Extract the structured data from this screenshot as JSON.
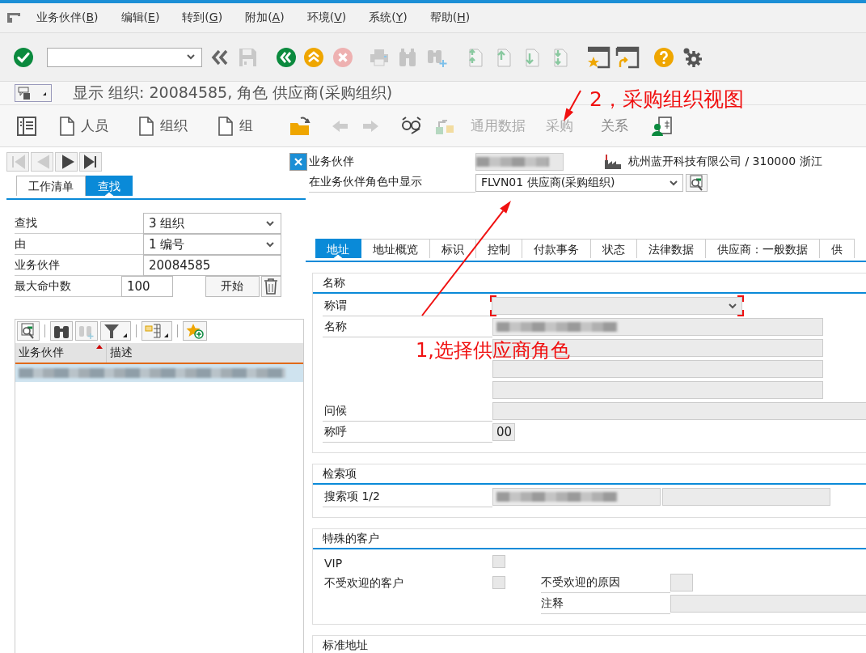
{
  "menu_bar": {
    "items": [
      "业务伙伴(B)",
      "编辑(E)",
      "转到(G)",
      "附加(A)",
      "环境(V)",
      "系统(Y)",
      "帮助(H)"
    ]
  },
  "title": "显示 组织: 20084585, 角色 供应商(采购组织)",
  "app_toolbar": {
    "create_buttons": [
      "人员",
      "组织",
      "组"
    ],
    "views": [
      {
        "label": "通用数据",
        "disabled": true
      },
      {
        "label": "采购",
        "disabled": true
      },
      {
        "label": "关系",
        "disabled": false
      }
    ]
  },
  "locator": {
    "tabs": [
      {
        "label": "工作清单",
        "selected": false
      },
      {
        "label": "查找",
        "selected": true
      }
    ],
    "search_fields": [
      {
        "label": "查找",
        "kind": "dropdown",
        "value": "3 组织"
      },
      {
        "label": "由",
        "kind": "dropdown",
        "value": "1 编号"
      },
      {
        "label": "业务伙伴",
        "kind": "text",
        "value": "20084585"
      },
      {
        "label": "最大命中数",
        "kind": "short",
        "value": "100"
      }
    ],
    "start_button": "开始",
    "results": {
      "columns": [
        "业务伙伴",
        "描述"
      ],
      "rows": [
        {
          "redacted": true,
          "selected": true
        }
      ]
    }
  },
  "header": {
    "partner": {
      "label": "业务伙伴",
      "redacted": true
    },
    "company": "杭州蓝开科技有限公司 / 310000 浙江",
    "role_label": "在业务伙伴角色中显示",
    "role_value": "FLVN01 供应商(采购组织)"
  },
  "tabs": [
    {
      "label": "地址",
      "selected": true
    },
    {
      "label": "地址概览",
      "selected": false
    },
    {
      "label": "标识",
      "selected": false
    },
    {
      "label": "控制",
      "selected": false
    },
    {
      "label": "付款事务",
      "selected": false
    },
    {
      "label": "状态",
      "selected": false
    },
    {
      "label": "法律数据",
      "selected": false
    },
    {
      "label": "供应商：一般数据",
      "selected": false
    },
    {
      "label": "供",
      "selected": false
    }
  ],
  "sections": [
    {
      "title": "名称",
      "rows": [
        {
          "kind": "dropdown",
          "label": "称谓",
          "focused": true
        },
        {
          "kind": "text",
          "label": "名称",
          "redacted": true
        },
        {
          "kind": "text",
          "redacted": false
        },
        {
          "kind": "text",
          "redacted": false
        },
        {
          "kind": "text",
          "redacted": false
        },
        {
          "kind": "wide",
          "label": "问候"
        },
        {
          "kind": "short",
          "label": "称呼",
          "value": "00"
        }
      ]
    },
    {
      "title": "检索项",
      "rows": [
        {
          "kind": "pair",
          "label": "搜索项 1/2",
          "redacted": true
        }
      ]
    },
    {
      "title": "特殊的客户",
      "rows": [
        {
          "kind": "checkbox",
          "label": "VIP",
          "checked": false
        },
        {
          "kind": "checkbox",
          "label": "不受欢迎的客户",
          "checked": false,
          "extra": {
            "label": "不受欢迎的原因"
          }
        },
        {
          "kind": "note",
          "label": "注释"
        }
      ]
    },
    {
      "title": "标准地址"
    }
  ],
  "annotations": [
    {
      "text": "2，采购组织视图"
    },
    {
      "text": "1,选择供应商角色"
    }
  ]
}
